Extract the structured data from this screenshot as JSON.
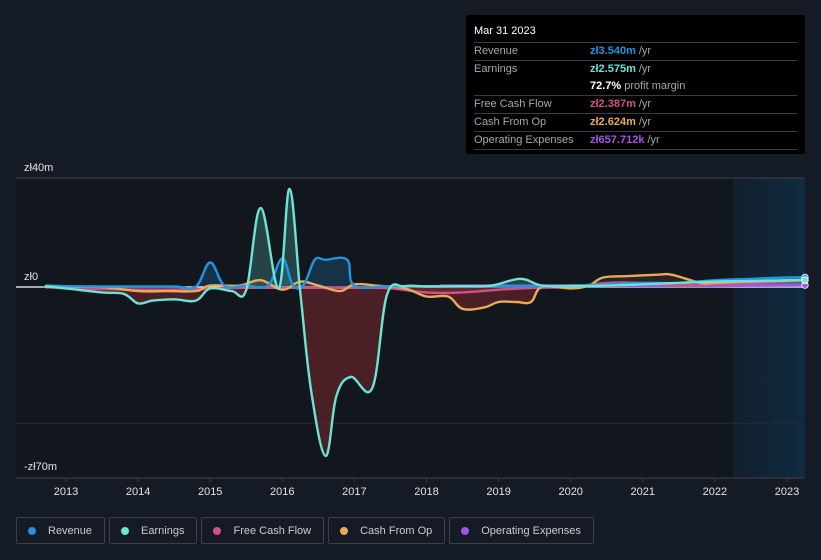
{
  "tooltip": {
    "date": "Mar 31 2023",
    "rows": [
      {
        "label": "Revenue",
        "value": "zł3.540m",
        "unit": "/yr",
        "color": "#2394df"
      },
      {
        "label": "Earnings",
        "value": "zł2.575m",
        "unit": "/yr",
        "color": "#6ce4d4"
      },
      {
        "label": "",
        "value": "72.7%",
        "unit": "profit margin",
        "color": "#ffffff"
      },
      {
        "label": "Free Cash Flow",
        "value": "zł2.387m",
        "unit": "/yr",
        "color": "#d2508a"
      },
      {
        "label": "Cash From Op",
        "value": "zł2.624m",
        "unit": "/yr",
        "color": "#e9ab5a"
      },
      {
        "label": "Operating Expenses",
        "value": "zł657.712k",
        "unit": "/yr",
        "color": "#a453ea"
      }
    ]
  },
  "legend": [
    {
      "label": "Revenue",
      "color": "#2394df"
    },
    {
      "label": "Earnings",
      "color": "#6ce4d4"
    },
    {
      "label": "Free Cash Flow",
      "color": "#d2508a"
    },
    {
      "label": "Cash From Op",
      "color": "#e9ab5a"
    },
    {
      "label": "Operating Expenses",
      "color": "#a453ea"
    }
  ],
  "chart_data": {
    "type": "line",
    "title": "",
    "xlabel": "",
    "ylabel": "",
    "currency": "zł",
    "y_tick_labels": [
      "zł40m",
      "zł0",
      "-zł70m"
    ],
    "ylim": [
      -70,
      40
    ],
    "xlim": [
      2012.75,
      2023.25
    ],
    "x_tick_labels": [
      "2013",
      "2014",
      "2015",
      "2016",
      "2017",
      "2018",
      "2019",
      "2020",
      "2021",
      "2022",
      "2023"
    ],
    "x_ticks": [
      2013,
      2014,
      2015,
      2016,
      2017,
      2018,
      2019,
      2020,
      2021,
      2022,
      2023
    ],
    "highlight_range": [
      2022.25,
      2023.25
    ],
    "unit": "zł millions",
    "series": [
      {
        "name": "Revenue",
        "color": "#2394df",
        "x": [
          2012.6,
          2013.0,
          2013.5,
          2014.0,
          2014.5,
          2014.8,
          2015.0,
          2015.2,
          2015.5,
          2015.8,
          2016.0,
          2016.15,
          2016.3,
          2016.45,
          2016.6,
          2016.9,
          2017.0,
          2017.5,
          2018.0,
          2018.5,
          2019.0,
          2019.5,
          2020.0,
          2020.5,
          2021.0,
          2021.5,
          2022.0,
          2022.5,
          2023.0,
          2023.25
        ],
        "y": [
          0.5,
          0.3,
          0.2,
          0.2,
          0.2,
          0.2,
          9.0,
          0.5,
          0.5,
          0.5,
          10.5,
          0.5,
          1.0,
          10.0,
          10.0,
          10.0,
          0.5,
          0.3,
          0.3,
          0.3,
          0.3,
          0.3,
          0.5,
          1.0,
          1.5,
          1.5,
          2.5,
          3.0,
          3.5,
          3.54
        ]
      },
      {
        "name": "Earnings",
        "color": "#6ce4d4",
        "x": [
          2012.6,
          2013.0,
          2013.5,
          2013.8,
          2014.0,
          2014.2,
          2014.5,
          2014.8,
          2015.0,
          2015.3,
          2015.5,
          2015.7,
          2015.95,
          2016.1,
          2016.25,
          2016.4,
          2016.6,
          2016.75,
          2016.95,
          2017.25,
          2017.45,
          2017.7,
          2018.0,
          2018.5,
          2018.9,
          2019.3,
          2019.6,
          2020.0,
          2020.5,
          2021.0,
          2021.5,
          2022.0,
          2022.5,
          2023.0,
          2023.25
        ],
        "y": [
          0.3,
          -0.5,
          -2.0,
          -2.5,
          -6.0,
          -5.0,
          -4.5,
          -5.0,
          -0.5,
          -1.5,
          -1.0,
          29.0,
          -0.5,
          36.0,
          -2.0,
          -38.0,
          -62.0,
          -40.0,
          -33.0,
          -37.0,
          -3.0,
          0.3,
          0.2,
          0.3,
          0.5,
          3.0,
          0.5,
          0.3,
          0.5,
          1.0,
          1.5,
          2.0,
          2.2,
          2.5,
          2.575
        ]
      },
      {
        "name": "Free Cash Flow",
        "color": "#d2508a",
        "x": [
          2012.6,
          2013.0,
          2013.5,
          2014.0,
          2014.5,
          2015.0,
          2015.5,
          2016.0,
          2016.5,
          2017.0,
          2017.5,
          2018.0,
          2018.5,
          2019.0,
          2019.5,
          2020.0,
          2020.5,
          2021.0,
          2021.5,
          2022.0,
          2022.5,
          2023.0,
          2023.25
        ],
        "y": [
          0.0,
          -0.5,
          -0.8,
          -1.0,
          -1.0,
          -0.5,
          -0.3,
          -0.3,
          -0.3,
          -0.3,
          -0.5,
          -2.0,
          -2.0,
          -1.0,
          -0.3,
          0.0,
          1.5,
          1.5,
          0.5,
          1.0,
          1.5,
          2.2,
          2.387
        ]
      },
      {
        "name": "Cash From Op",
        "color": "#e9ab5a",
        "x": [
          2012.6,
          2013.0,
          2013.5,
          2014.0,
          2014.4,
          2014.8,
          2015.0,
          2015.4,
          2015.7,
          2016.0,
          2016.25,
          2016.5,
          2016.8,
          2017.0,
          2017.3,
          2017.7,
          2018.0,
          2018.3,
          2018.5,
          2018.8,
          2019.0,
          2019.25,
          2019.45,
          2019.6,
          2020.0,
          2020.25,
          2020.45,
          2020.8,
          2021.2,
          2021.4,
          2021.8,
          2022.0,
          2022.5,
          2023.0,
          2023.25
        ],
        "y": [
          0.0,
          0.0,
          0.0,
          -1.5,
          -1.5,
          -1.5,
          0.5,
          0.5,
          2.5,
          -1.0,
          2.0,
          0.5,
          -1.5,
          1.0,
          0.5,
          -0.5,
          -3.5,
          -3.5,
          -8.0,
          -7.5,
          -5.5,
          -5.5,
          -5.5,
          0.0,
          -0.5,
          0.5,
          3.5,
          4.0,
          4.5,
          4.5,
          1.5,
          1.5,
          2.0,
          2.3,
          2.624
        ]
      },
      {
        "name": "Operating Expenses",
        "color": "#a453ea",
        "x": [
          2018.2,
          2018.5,
          2019.0,
          2019.5,
          2020.0,
          2020.5,
          2021.0,
          2021.5,
          2022.0,
          2022.5,
          2023.0,
          2023.25
        ],
        "y": [
          0.4,
          0.4,
          0.4,
          0.4,
          0.5,
          0.5,
          0.5,
          0.5,
          0.5,
          0.6,
          0.65,
          0.658
        ]
      }
    ]
  }
}
